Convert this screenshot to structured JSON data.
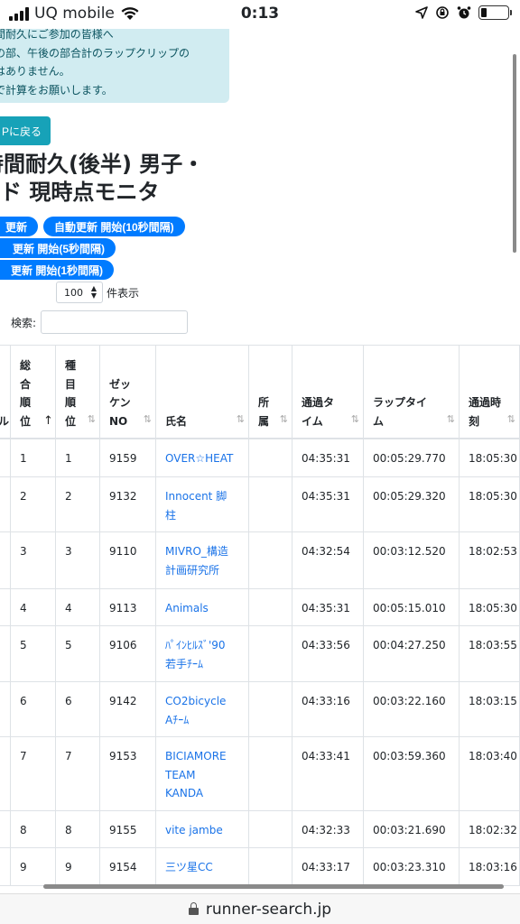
{
  "status_bar": {
    "carrier": "UQ mobile",
    "time": "0:13",
    "battery_level": 0.2
  },
  "notice": {
    "lines": [
      "時間耐久にご参加の皆様へ",
      "前の部、午後の部合計のラップクリップの",
      "載はありません。",
      "自で計算をお願いします。"
    ]
  },
  "top_button": "Pに戻る",
  "title": {
    "line1": "時間耐久(後半) 男子・",
    "line2": "ード 現時点モニタ"
  },
  "refresh_buttons": [
    "」更新",
    "自動更新 開始(10秒間隔)",
    "更新 開始(5秒間隔)",
    "更新 開始(1秒間隔)"
  ],
  "length": {
    "value": "100",
    "label": "件表示"
  },
  "search": {
    "label": "検索:"
  },
  "table": {
    "headers": [
      {
        "label": "ル",
        "sort": "⇅"
      },
      {
        "label": "総\n合\n順\n位",
        "sort": "↑"
      },
      {
        "label": "種\n目\n順\n位",
        "sort": "⇅"
      },
      {
        "label": "ゼッ\nケン\nNO",
        "sort": "⇅"
      },
      {
        "label": "氏名",
        "sort": "⇅"
      },
      {
        "label": "所\n属",
        "sort": "⇅"
      },
      {
        "label": "通過タ\nイム",
        "sort": "⇅"
      },
      {
        "label": "ラップタイ\nム",
        "sort": "⇅"
      },
      {
        "label": "通過時\n刻",
        "sort": "⇅"
      }
    ],
    "rows": [
      {
        "overall": "1",
        "event": "1",
        "bib": "9159",
        "name": "OVER☆HEAT",
        "affil": "",
        "pass_time": "04:35:31",
        "lap": "00:05:29.770",
        "clock": "18:05:30"
      },
      {
        "overall": "2",
        "event": "2",
        "bib": "9132",
        "name": "Innocent 脚\n柱",
        "affil": "",
        "pass_time": "04:35:31",
        "lap": "00:05:29.320",
        "clock": "18:05:30"
      },
      {
        "overall": "3",
        "event": "3",
        "bib": "9110",
        "name": "MIVRO_構造\n計画研究所",
        "affil": "",
        "pass_time": "04:32:54",
        "lap": "00:03:12.520",
        "clock": "18:02:53"
      },
      {
        "overall": "4",
        "event": "4",
        "bib": "9113",
        "name": "Animals",
        "affil": "",
        "pass_time": "04:35:31",
        "lap": "00:05:15.010",
        "clock": "18:05:30"
      },
      {
        "overall": "5",
        "event": "5",
        "bib": "9106",
        "name": "ﾊﾟｲﾝﾋﾙｽﾞ'90\n若手ﾁｰﾑ",
        "affil": "",
        "pass_time": "04:33:56",
        "lap": "00:04:27.250",
        "clock": "18:03:55"
      },
      {
        "overall": "6",
        "event": "6",
        "bib": "9142",
        "name": "CO2bicycle\nAﾁｰﾑ",
        "affil": "",
        "pass_time": "04:33:16",
        "lap": "00:03:22.160",
        "clock": "18:03:15"
      },
      {
        "overall": "7",
        "event": "7",
        "bib": "9153",
        "name": "BICIAMORE\nTEAM\nKANDA",
        "affil": "",
        "pass_time": "04:33:41",
        "lap": "00:03:59.360",
        "clock": "18:03:40"
      },
      {
        "overall": "8",
        "event": "8",
        "bib": "9155",
        "name": "vite jambe",
        "affil": "",
        "pass_time": "04:32:33",
        "lap": "00:03:21.690",
        "clock": "18:02:32"
      },
      {
        "overall": "9",
        "event": "9",
        "bib": "9154",
        "name": "三ツ星CC",
        "affil": "",
        "pass_time": "04:33:17",
        "lap": "00:03:23.310",
        "clock": "18:03:16"
      }
    ]
  },
  "url_bar": {
    "domain": "runner-search.jp"
  }
}
